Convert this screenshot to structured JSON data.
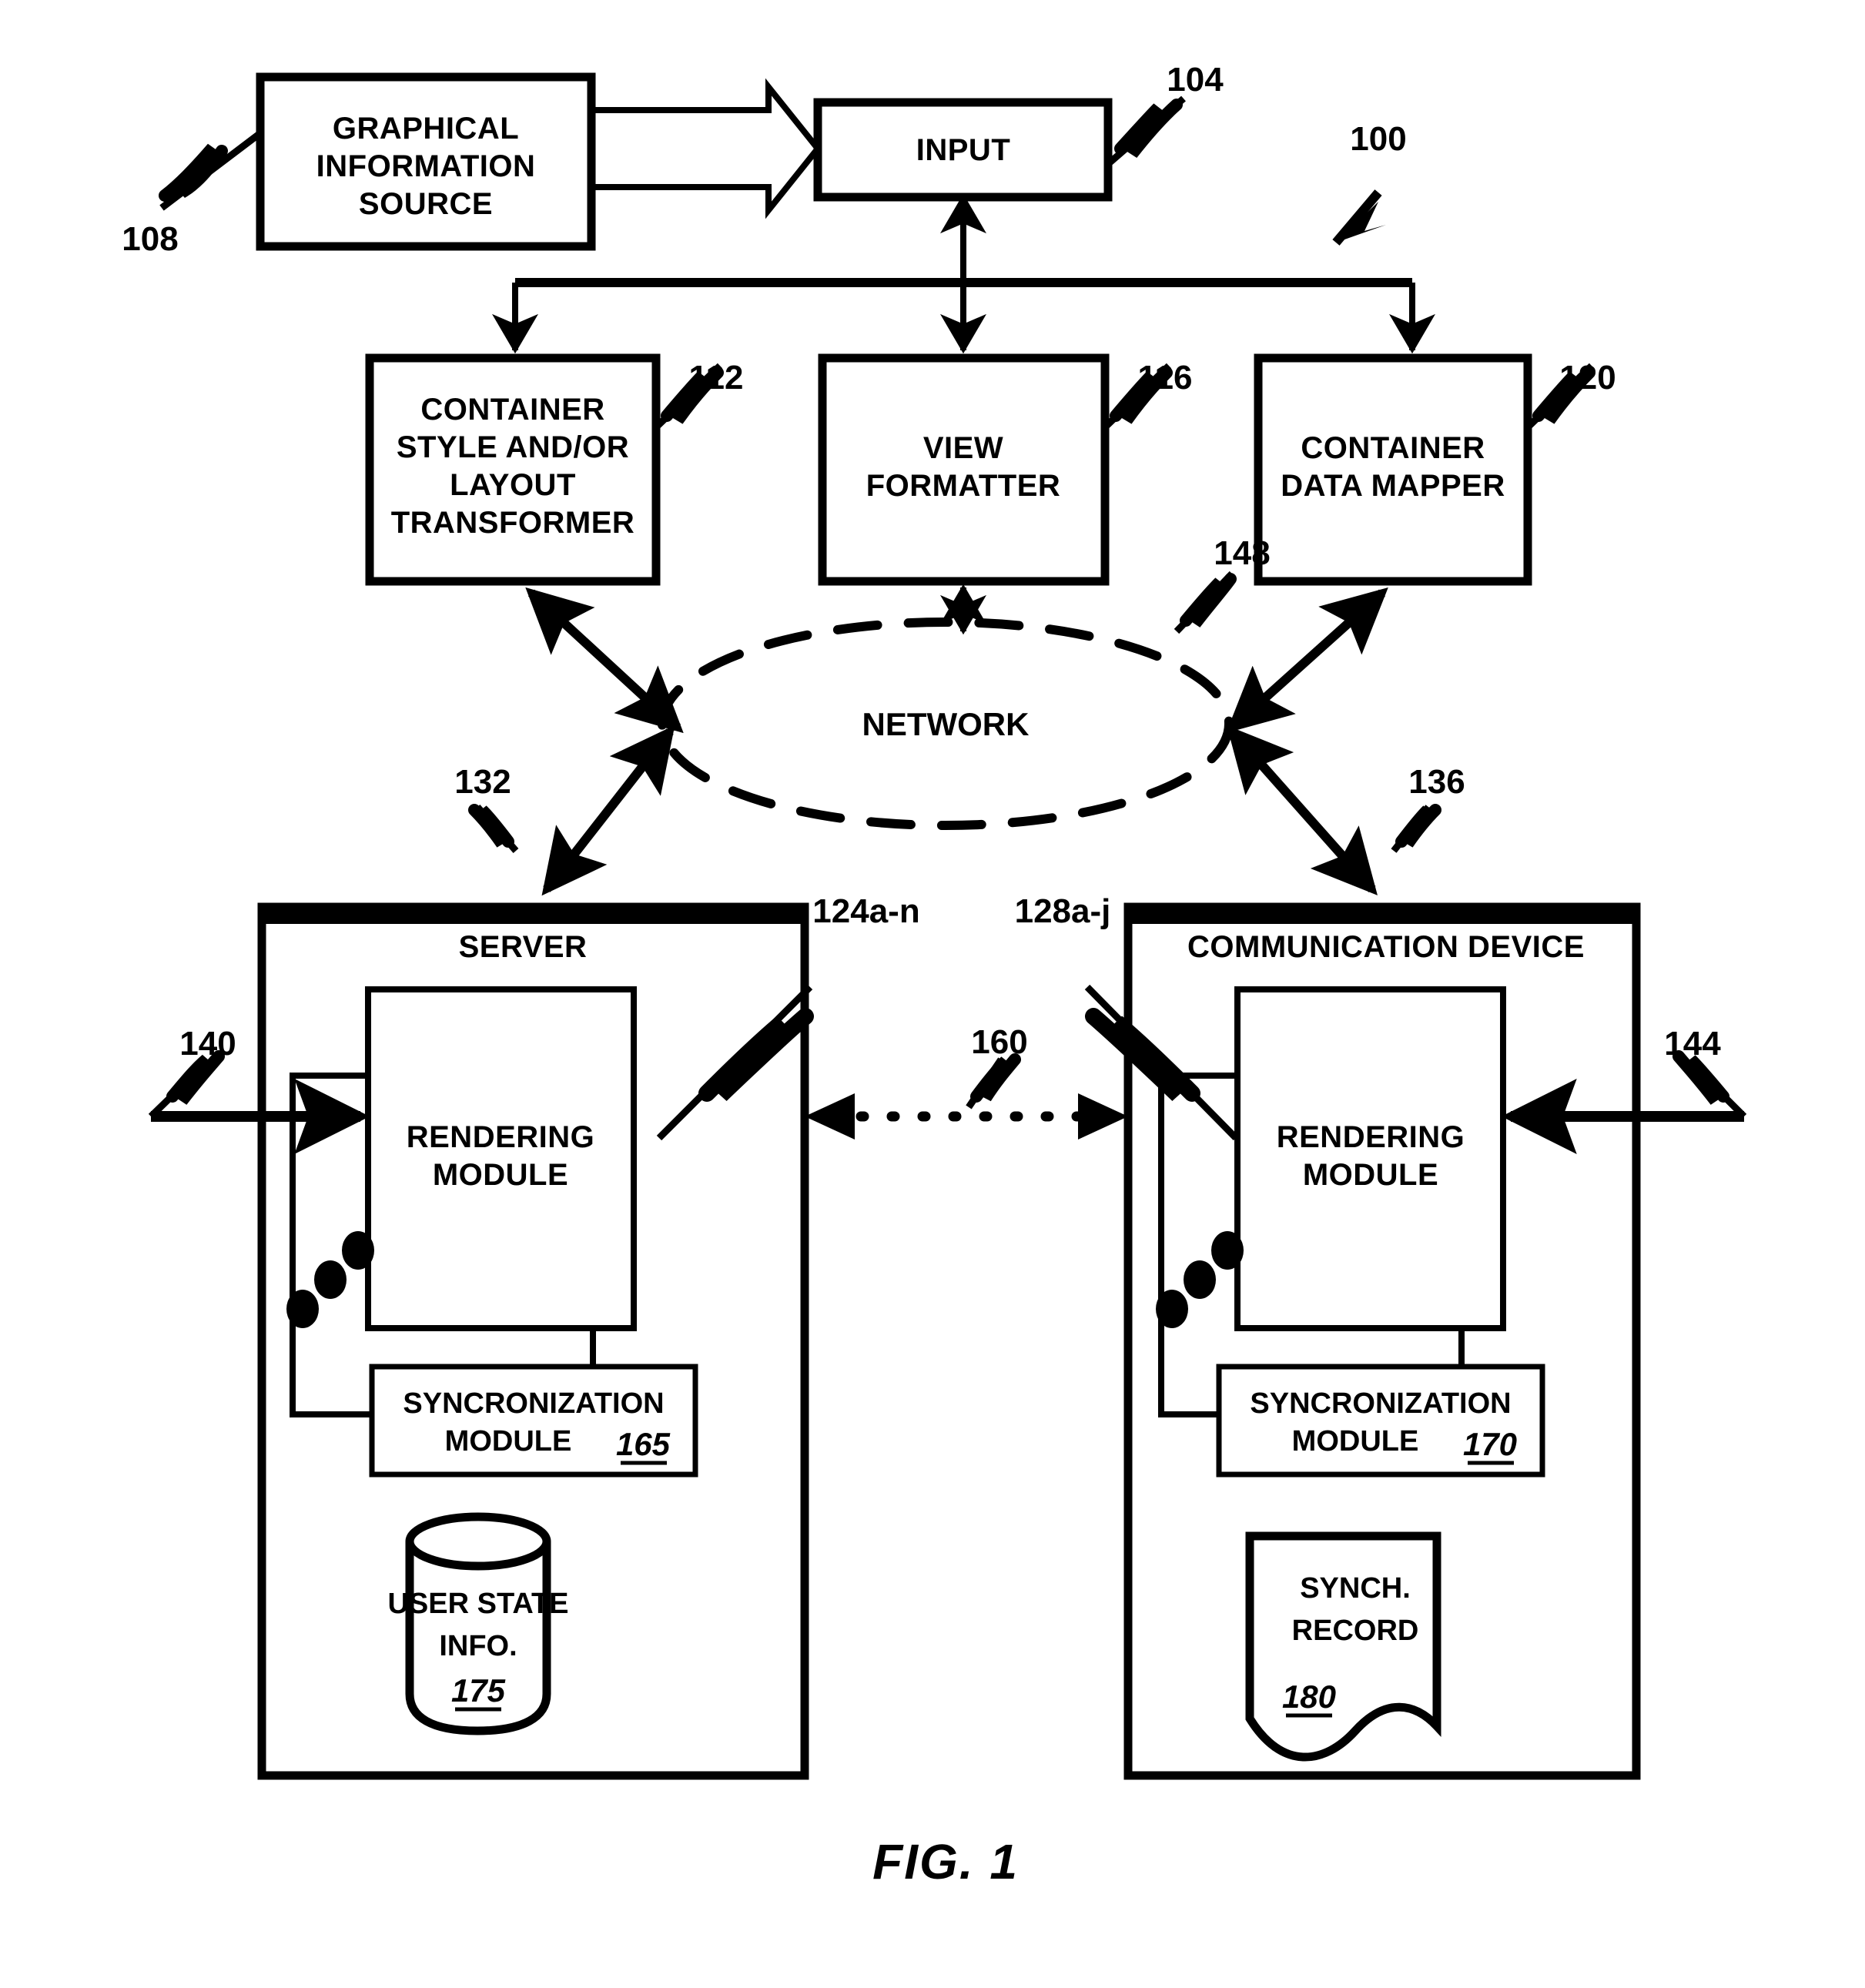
{
  "figure": {
    "caption": "FIG. 1",
    "system_ref": "100"
  },
  "blocks": {
    "graphical_information_source": {
      "lines": [
        "GRAPHICAL",
        "INFORMATION",
        "SOURCE"
      ],
      "ref": "108"
    },
    "input": {
      "label": "INPUT",
      "ref": "104"
    },
    "container_style_layout_transformer": {
      "lines": [
        "CONTAINER",
        "STYLE AND/OR",
        "LAYOUT",
        "TRANSFORMER"
      ],
      "ref": "112"
    },
    "view_formatter": {
      "lines": [
        "VIEW",
        "FORMATTER"
      ],
      "ref": "116"
    },
    "container_data_mapper": {
      "lines": [
        "CONTAINER",
        "DATA MAPPER"
      ],
      "ref": "120"
    },
    "network": {
      "label": "NETWORK",
      "ref": "148"
    },
    "server": {
      "title": "SERVER",
      "ref": "132",
      "input_arrow_ref": "140",
      "rendering_module": {
        "lines": [
          "RENDERING",
          "MODULE"
        ],
        "ref": "124a-n"
      },
      "sync_module": {
        "lines": [
          "SYNCRONIZATION",
          "MODULE"
        ],
        "ref": "165"
      },
      "user_state_store": {
        "lines": [
          "USER STATE",
          "INFO."
        ],
        "ref": "175"
      }
    },
    "communication_device": {
      "title": "COMMUNICATION DEVICE",
      "ref": "136",
      "input_arrow_ref": "144",
      "rendering_module": {
        "lines": [
          "RENDERING",
          "MODULE"
        ],
        "ref": "128a-j"
      },
      "sync_module": {
        "lines": [
          "SYNCRONIZATION",
          "MODULE"
        ],
        "ref": "170"
      },
      "synch_record": {
        "lines": [
          "SYNCH.",
          "RECORD"
        ],
        "ref": "180"
      }
    },
    "peer_link": {
      "ref": "160"
    }
  },
  "colors": {
    "line": "#000000",
    "background": "#ffffff"
  }
}
